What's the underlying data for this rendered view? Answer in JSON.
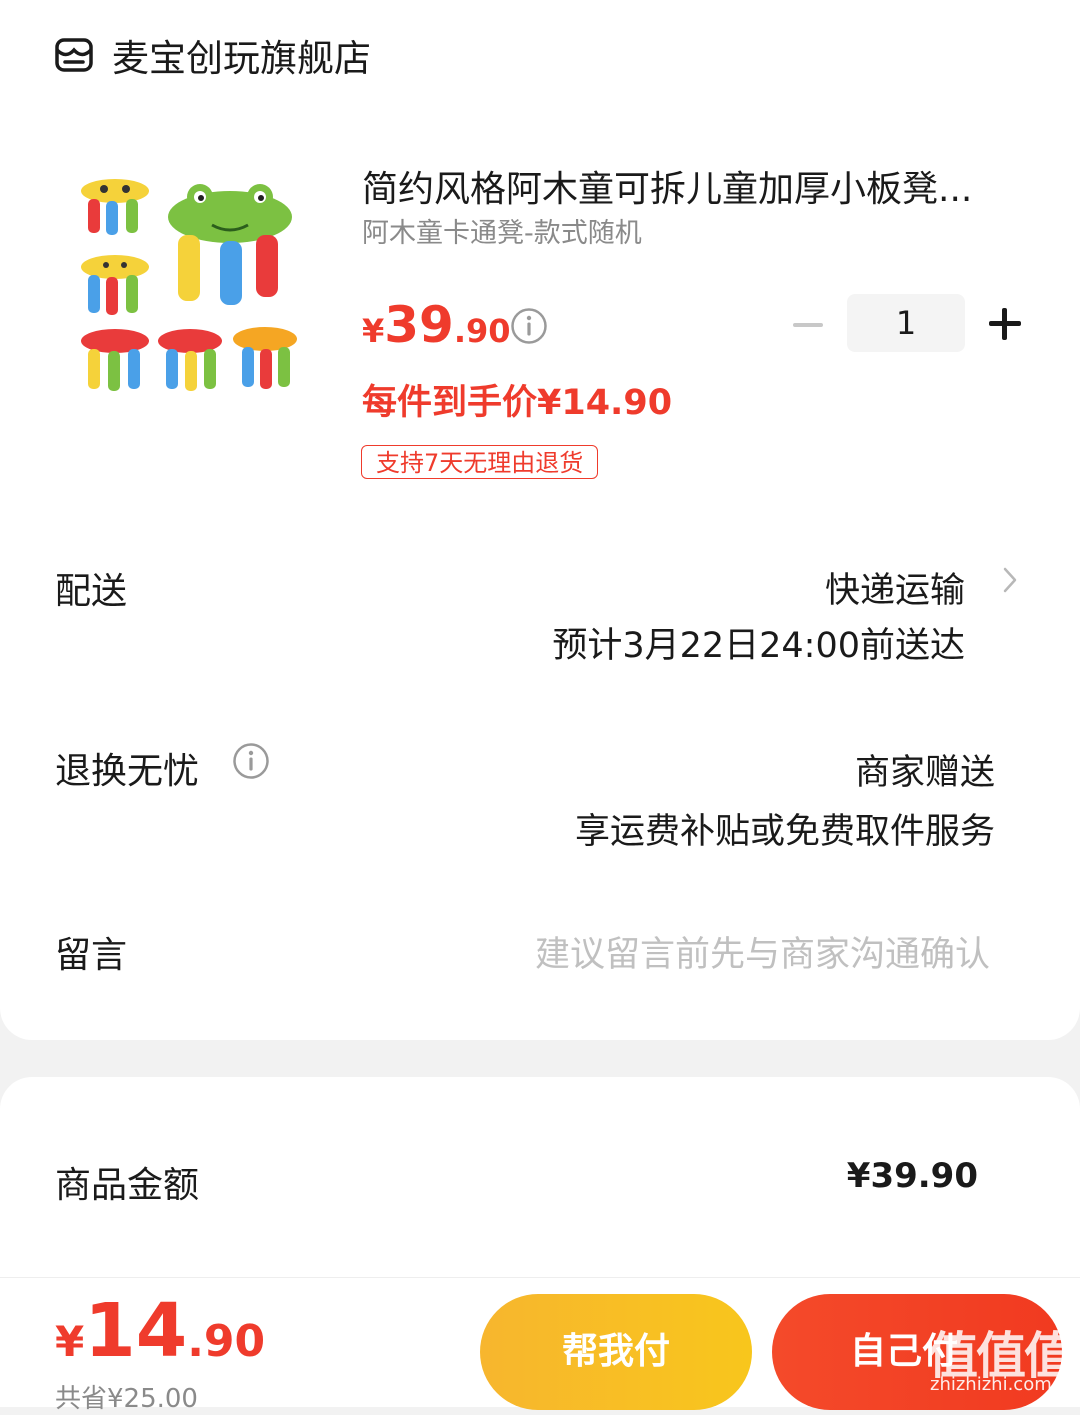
{
  "store": {
    "name": "麦宝创玩旗舰店",
    "icon": "store-icon"
  },
  "product": {
    "title": "简约风格阿木童可拆儿童加厚小板凳...",
    "spec": "阿木童卡通凳-款式随机",
    "price_currency": "¥",
    "price_int": "39",
    "price_dec": ".90",
    "deal_price": "每件到手价¥14.90",
    "return_badge": "支持7天无理由退货",
    "quantity": "1"
  },
  "delivery": {
    "label": "配送",
    "method": "快递运输",
    "eta": "预计3月22日24:00前送达"
  },
  "returns": {
    "label": "退换无忧",
    "gift": "商家赠送",
    "desc": "享运费补贴或免费取件服务"
  },
  "note": {
    "label": "留言",
    "placeholder": "建议留言前先与商家沟通确认"
  },
  "summary": {
    "subtotal_label": "商品金额",
    "subtotal_value": "¥39.90"
  },
  "footer": {
    "total_currency": "¥",
    "total_int": "14",
    "total_dec": ".90",
    "saved": "共省¥25.00",
    "help_pay": "帮我付",
    "self_pay": "自己付",
    "watermark": "值值值",
    "watermark_site": "zhizhizhi.com"
  },
  "colors": {
    "accent": "#ef3b2c",
    "yellow": "#f8c61c",
    "red": "#f13a20"
  }
}
